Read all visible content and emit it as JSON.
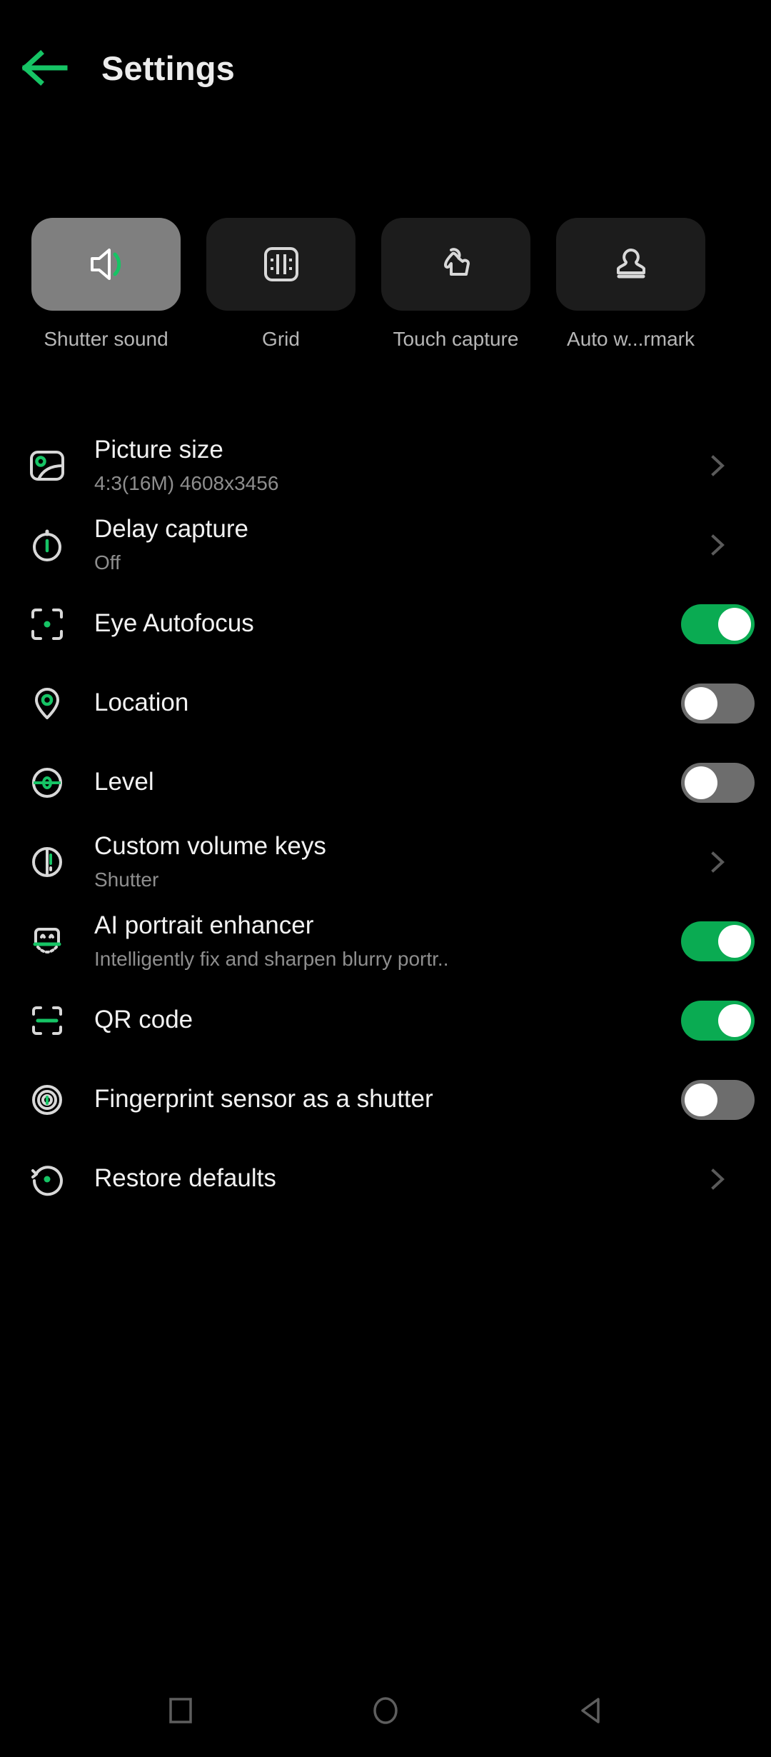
{
  "header": {
    "title": "Settings",
    "back_icon": "arrow-left-icon",
    "accent_color": "#16c465"
  },
  "tiles": [
    {
      "label": "Shutter sound",
      "icon": "speaker-sound-icon",
      "active": true
    },
    {
      "label": "Grid",
      "icon": "grid-icon",
      "active": false
    },
    {
      "label": "Touch capture",
      "icon": "touch-hand-icon",
      "active": false
    },
    {
      "label": "Auto w...rmark",
      "icon": "watermark-stamp-icon",
      "active": false
    }
  ],
  "settings": [
    {
      "title": "Picture size",
      "subtitle": "4:3(16M) 4608x3456",
      "icon": "photo-size-icon",
      "control": "chevron"
    },
    {
      "title": "Delay capture",
      "subtitle": "Off",
      "icon": "timer-icon",
      "control": "chevron"
    },
    {
      "title": "Eye Autofocus",
      "subtitle": "",
      "icon": "focus-eye-icon",
      "control": "switch",
      "on": true
    },
    {
      "title": "Location",
      "subtitle": "",
      "icon": "location-pin-icon",
      "control": "switch",
      "on": false
    },
    {
      "title": "Level",
      "subtitle": "",
      "icon": "level-bubble-icon",
      "control": "switch",
      "on": false
    },
    {
      "title": "Custom volume keys",
      "subtitle": "Shutter",
      "icon": "volume-keys-icon",
      "control": "chevron"
    },
    {
      "title": "AI portrait enhancer",
      "subtitle": "Intelligently fix and sharpen blurry portr..",
      "icon": "ai-face-icon",
      "control": "switch",
      "on": true
    },
    {
      "title": "QR code",
      "subtitle": "",
      "icon": "qr-scan-icon",
      "control": "switch",
      "on": true
    },
    {
      "title": "Fingerprint sensor as a shutter",
      "subtitle": "",
      "icon": "fingerprint-icon",
      "control": "switch",
      "on": false
    },
    {
      "title": "Restore defaults",
      "subtitle": "",
      "icon": "restore-icon",
      "control": "chevron"
    }
  ],
  "navbar": [
    {
      "name": "recents-button",
      "icon": "square-icon"
    },
    {
      "name": "home-button",
      "icon": "circle-icon"
    },
    {
      "name": "back-button",
      "icon": "triangle-left-icon"
    }
  ],
  "colors": {
    "accent_green": "#16c465",
    "toggle_on": "#0aab52",
    "toggle_off": "#6d6d6d",
    "tile_bg": "#1c1c1c",
    "tile_active_bg": "#7f7f7f",
    "background": "#000000",
    "title_text": "#f2f2f2",
    "sub_text": "#8e8e8e",
    "icon_stroke": "#d8d8d8"
  }
}
